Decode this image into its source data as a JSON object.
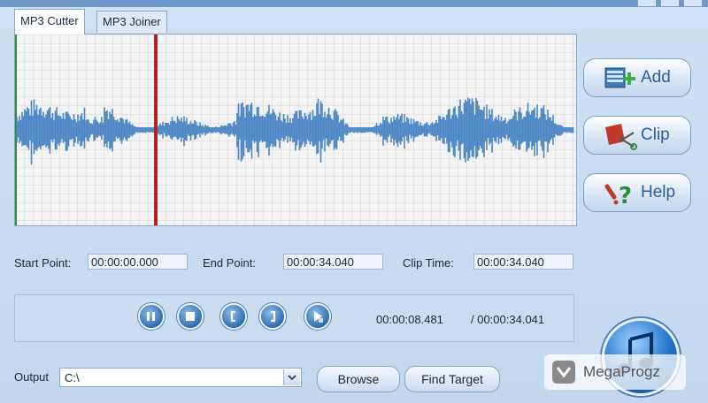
{
  "tabs": [
    {
      "label": "MP3 Cutter",
      "active": true
    },
    {
      "label": "MP3 Joiner",
      "active": false
    }
  ],
  "side_buttons": {
    "add": "Add",
    "clip": "Clip",
    "help": "Help"
  },
  "fields": {
    "start_label": "Start Point:",
    "start_value": "00:00:00.000",
    "end_label": "End Point:",
    "end_value": "00:00:34.040",
    "clip_label": "Clip Time:",
    "clip_value": "00:00:34.040"
  },
  "playback": {
    "current_time": "00:00:08.481",
    "total_time": "/ 00:00:34.041",
    "buttons": [
      "pause",
      "stop",
      "mark-start",
      "mark-end",
      "play-selection"
    ]
  },
  "output": {
    "label": "Output",
    "value": "C:\\",
    "browse": "Browse",
    "find_target": "Find Target"
  },
  "watermark": "MegaProgz",
  "colors": {
    "waveform": "#4a86c5",
    "playhead": "#b22222",
    "accent": "#2b5f9c"
  }
}
